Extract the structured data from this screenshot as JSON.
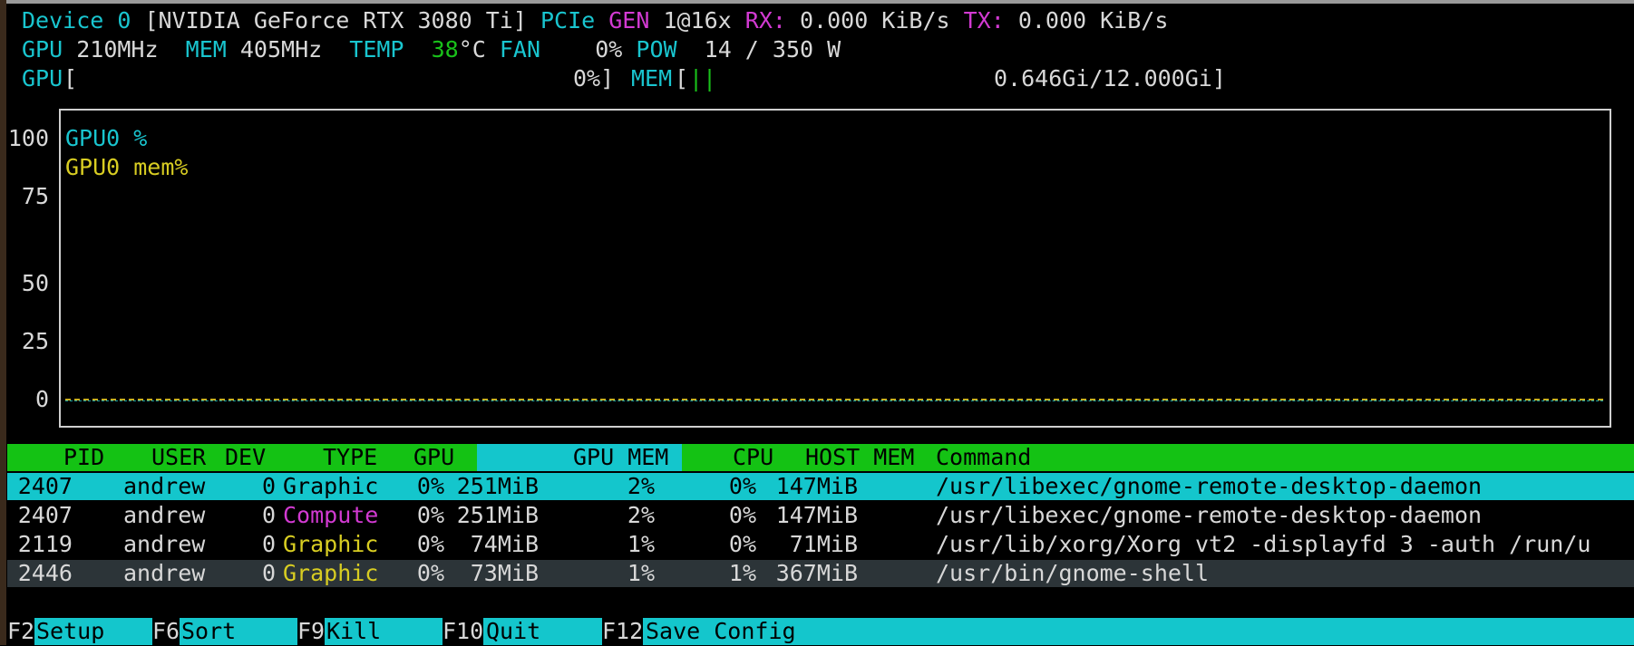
{
  "device_line": {
    "device_label": "Device 0",
    "device_name": " [NVIDIA GeForce RTX 3080 Ti] ",
    "pcie_label": "PCIe ",
    "gen_label": "GEN ",
    "gen_value": "1@16x ",
    "rx_label": "RX: ",
    "rx_value": "0.000 KiB/s ",
    "tx_label": "TX: ",
    "tx_value": "0.000 KiB/s"
  },
  "clock_line": {
    "gpu_label": "GPU ",
    "gpu_value": "210MHz  ",
    "mem_label": "MEM ",
    "mem_value": "405MHz  ",
    "temp_label": "TEMP  ",
    "temp_value": "38",
    "temp_unit": "°C ",
    "fan_label": "FAN  ",
    "fan_value": "  0% ",
    "pow_label": "POW  ",
    "pow_value": "14 / 350 W"
  },
  "bars_line": {
    "gpu_label": "GPU",
    "gpu_open": "[",
    "gpu_value": "0%]",
    "mem_label": "MEM",
    "mem_open": "[",
    "mem_bars": "||",
    "mem_value": "0.646Gi/12.000Gi]"
  },
  "chart_data": {
    "type": "line",
    "ylim": [
      0,
      100
    ],
    "yticks": [
      "100",
      "75",
      "50",
      "25",
      "0"
    ],
    "series": [
      {
        "name": "GPU0 %",
        "color": "#19c5cf",
        "values": [
          0,
          0,
          0,
          0,
          0
        ]
      },
      {
        "name": "GPU0 mem%",
        "color": "#d8cd22",
        "values": [
          0,
          0,
          0,
          0,
          0
        ]
      }
    ]
  },
  "process_table": {
    "headers": {
      "pid": "PID",
      "user": "USER",
      "dev": "DEV",
      "type": "TYPE",
      "gpu": "GPU",
      "gpu_mem": "GPU MEM",
      "cpu": "CPU",
      "host_mem": "HOST MEM",
      "command": "Command"
    },
    "rows": [
      {
        "pid": "2407",
        "user": "andrew",
        "dev": "0",
        "type": "Graphic",
        "type_color": "#000000",
        "gpu": "0%",
        "gpu_mem": "251MiB",
        "gpu_mem_pct": "2%",
        "cpu": "0%",
        "host_mem": "147MiB",
        "command": "/usr/libexec/gnome-remote-desktop-daemon"
      },
      {
        "pid": "2407",
        "user": "andrew",
        "dev": "0",
        "type": "Compute",
        "type_color": "#d23ad2",
        "gpu": "0%",
        "gpu_mem": "251MiB",
        "gpu_mem_pct": "2%",
        "cpu": "0%",
        "host_mem": "147MiB",
        "command": "/usr/libexec/gnome-remote-desktop-daemon"
      },
      {
        "pid": "2119",
        "user": "andrew",
        "dev": "0",
        "type": "Graphic",
        "type_color": "#d8cd22",
        "gpu": "0%",
        "gpu_mem": "74MiB",
        "gpu_mem_pct": "1%",
        "cpu": "0%",
        "host_mem": "71MiB",
        "command": "/usr/lib/xorg/Xorg vt2 -displayfd 3 -auth /run/u"
      },
      {
        "pid": "2446",
        "user": "andrew",
        "dev": "0",
        "type": "Graphic",
        "type_color": "#d8cd22",
        "gpu": "0%",
        "gpu_mem": "73MiB",
        "gpu_mem_pct": "1%",
        "cpu": "1%",
        "host_mem": "367MiB",
        "command": "/usr/bin/gnome-shell"
      }
    ]
  },
  "footer": {
    "keys": [
      {
        "key": "F2",
        "label": "Setup"
      },
      {
        "key": "F6",
        "label": "Sort"
      },
      {
        "key": "F9",
        "label": "Kill"
      },
      {
        "key": "F10",
        "label": "Quit"
      },
      {
        "key": "F12",
        "label": "Save Config"
      }
    ]
  }
}
